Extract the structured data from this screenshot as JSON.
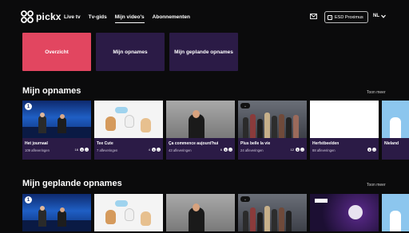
{
  "brand": {
    "name": "pickx"
  },
  "nav": [
    {
      "label": "Live tv",
      "active": false
    },
    {
      "label": "Tv-gids",
      "active": false
    },
    {
      "label": "Mijn video's",
      "active": true
    },
    {
      "label": "Abonnementen",
      "active": false
    }
  ],
  "header": {
    "account_label": "ESD Proximus",
    "language": "NL"
  },
  "tiles": [
    {
      "label": "Overzicht",
      "active": true
    },
    {
      "label": "Mijn opnames",
      "active": false
    },
    {
      "label": "Mijn geplande opnames",
      "active": false
    }
  ],
  "sections": [
    {
      "title": "Mijn opnames",
      "more": "Toon meer",
      "cards": [
        {
          "title": "Het journaal",
          "sub": "109 afleveringen",
          "badge": "16"
        },
        {
          "title": "Tee Cute",
          "sub": "7 afleveringen",
          "badge": "4"
        },
        {
          "title": "Ça commence aujourd'hui",
          "sub": "43 afleveringen",
          "badge": "6"
        },
        {
          "title": "Plus belle la vie",
          "sub": "24 afleveringen",
          "badge": "12"
        },
        {
          "title": "Herfstbeelden",
          "sub": "88 afleveringen",
          "badge": ""
        },
        {
          "title": "Nieland",
          "sub": "",
          "badge": ""
        }
      ]
    },
    {
      "title": "Mijn geplande opnames",
      "more": "Toon meer"
    }
  ],
  "colors": {
    "accent": "#e24660",
    "tile": "#2b1b46",
    "background": "#0b0b0c"
  },
  "icons": [
    "pickx-logo-icon",
    "mail-icon",
    "user-icon",
    "chevron-down-icon"
  ]
}
